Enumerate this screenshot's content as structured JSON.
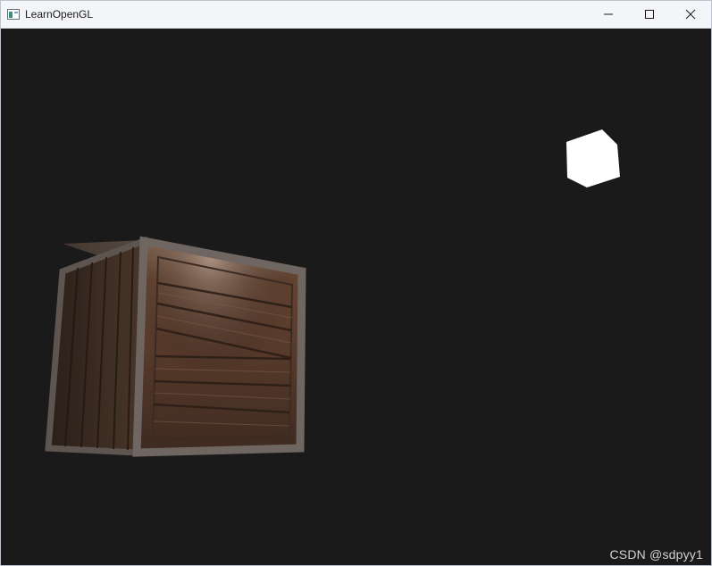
{
  "window": {
    "title": "LearnOpenGL",
    "icon": "opengl-app-icon",
    "controls": [
      "minimize-icon",
      "maximize-icon",
      "close-icon"
    ]
  },
  "scene": {
    "background_color": "#1a1a1a",
    "objects": [
      "wooden-crate",
      "light-cube"
    ],
    "light_color": "#ffffff"
  },
  "watermark": {
    "text": "CSDN @sdpyy1"
  }
}
